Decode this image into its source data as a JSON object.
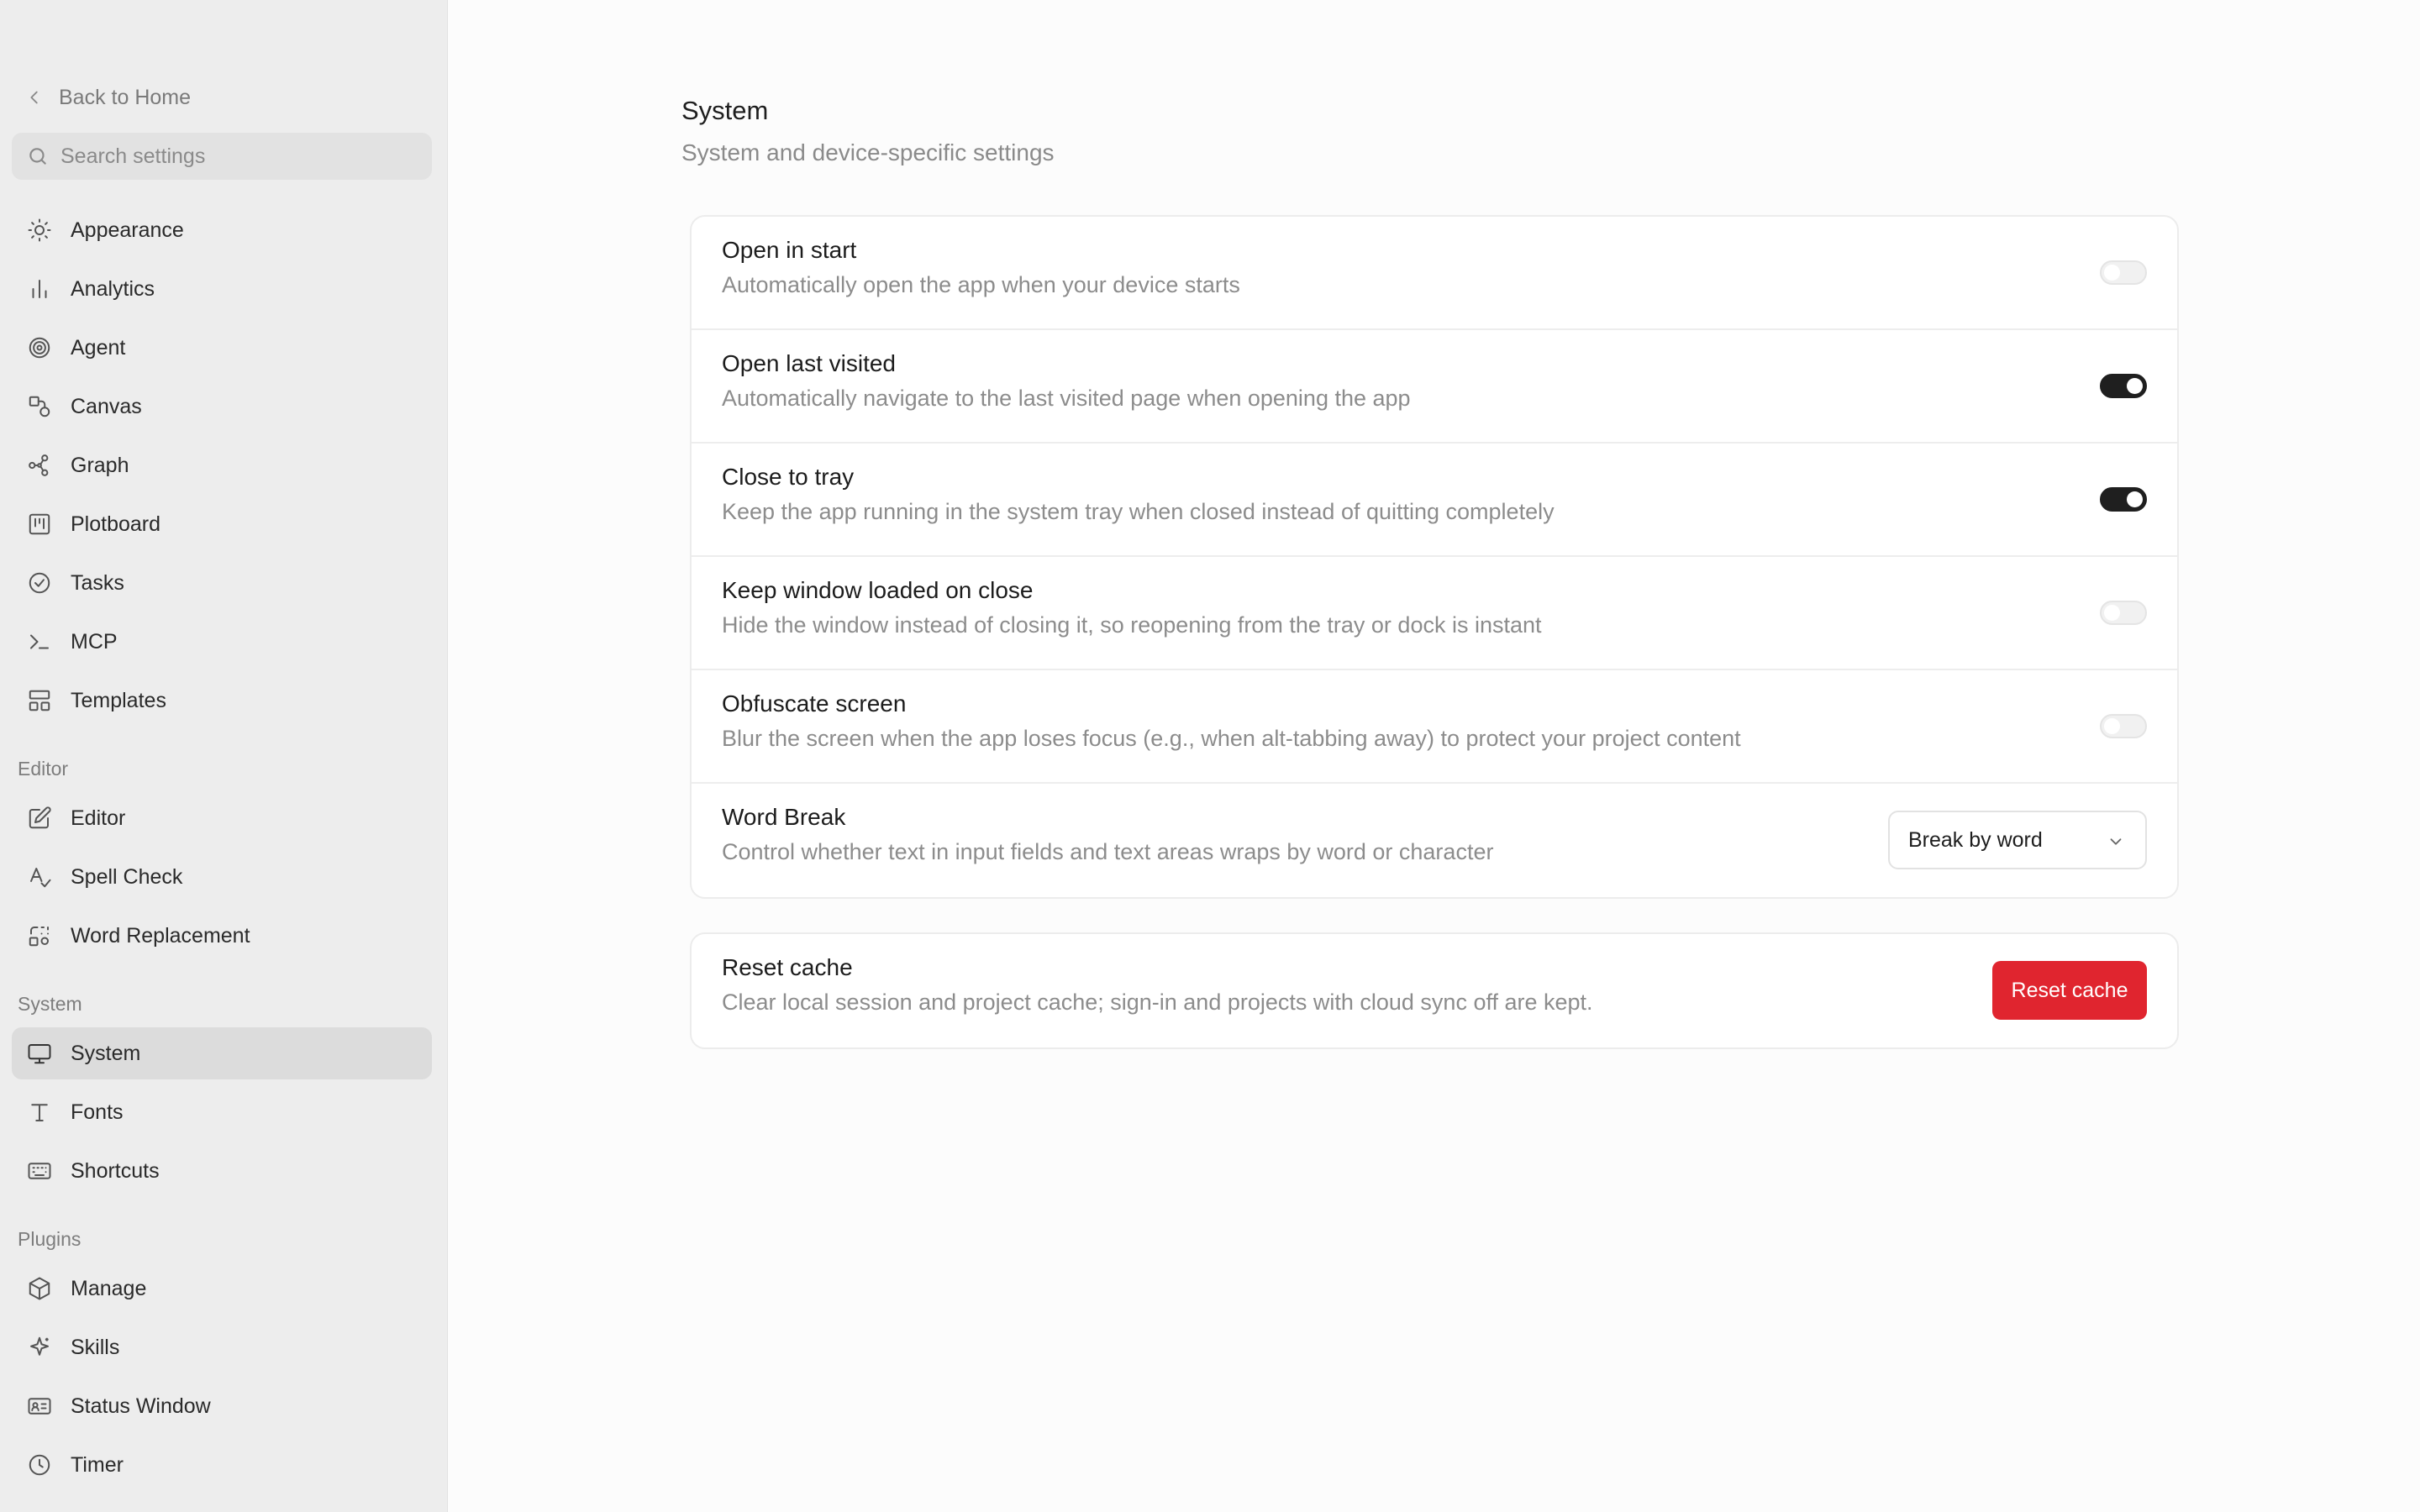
{
  "sidebar": {
    "back_label": "Back to Home",
    "search_placeholder": "Search settings",
    "items": [
      {
        "label": "Appearance",
        "icon": "sun-icon"
      },
      {
        "label": "Analytics",
        "icon": "bar-chart-icon"
      },
      {
        "label": "Agent",
        "icon": "spiral-icon"
      },
      {
        "label": "Canvas",
        "icon": "shapes-icon"
      },
      {
        "label": "Graph",
        "icon": "graph-icon"
      },
      {
        "label": "Plotboard",
        "icon": "kanban-icon"
      },
      {
        "label": "Tasks",
        "icon": "check-circle-icon"
      },
      {
        "label": "MCP",
        "icon": "terminal-icon"
      },
      {
        "label": "Templates",
        "icon": "layout-icon"
      }
    ],
    "groups": {
      "editor": {
        "label": "Editor",
        "items": [
          {
            "label": "Editor",
            "icon": "edit-icon"
          },
          {
            "label": "Spell Check",
            "icon": "spell-check-icon"
          },
          {
            "label": "Word Replacement",
            "icon": "replace-icon"
          }
        ]
      },
      "system": {
        "label": "System",
        "items": [
          {
            "label": "System",
            "icon": "monitor-icon",
            "active": true
          },
          {
            "label": "Fonts",
            "icon": "type-icon"
          },
          {
            "label": "Shortcuts",
            "icon": "keyboard-icon"
          }
        ]
      },
      "plugins": {
        "label": "Plugins",
        "items": [
          {
            "label": "Manage",
            "icon": "package-icon"
          },
          {
            "label": "Skills",
            "icon": "sparkle-icon"
          },
          {
            "label": "Status Window",
            "icon": "id-card-icon"
          },
          {
            "label": "Timer",
            "icon": "clock-icon"
          }
        ]
      }
    }
  },
  "main": {
    "title": "System",
    "subtitle": "System and device-specific settings",
    "settings": [
      {
        "title": "Open in start",
        "description": "Automatically open the app when your device starts",
        "enabled": false
      },
      {
        "title": "Open last visited",
        "description": "Automatically navigate to the last visited page when opening the app",
        "enabled": true
      },
      {
        "title": "Close to tray",
        "description": "Keep the app running in the system tray when closed instead of quitting completely",
        "enabled": true
      },
      {
        "title": "Keep window loaded on close",
        "description": "Hide the window instead of closing it, so reopening from the tray or dock is instant",
        "enabled": false
      },
      {
        "title": "Obfuscate screen",
        "description": "Blur the screen when the app loses focus (e.g., when alt-tabbing away) to protect your project content",
        "enabled": false
      }
    ],
    "word_break": {
      "title": "Word Break",
      "description": "Control whether text in input fields and text areas wraps by word or character",
      "selected": "Break by word"
    },
    "reset": {
      "title": "Reset cache",
      "description": "Clear local session and project cache; sign-in and projects with cloud sync off are kept.",
      "button_label": "Reset cache"
    }
  },
  "colors": {
    "danger": "#e0252f",
    "toggle_on": "#1f1f1f",
    "sidebar_bg": "#ededed"
  }
}
